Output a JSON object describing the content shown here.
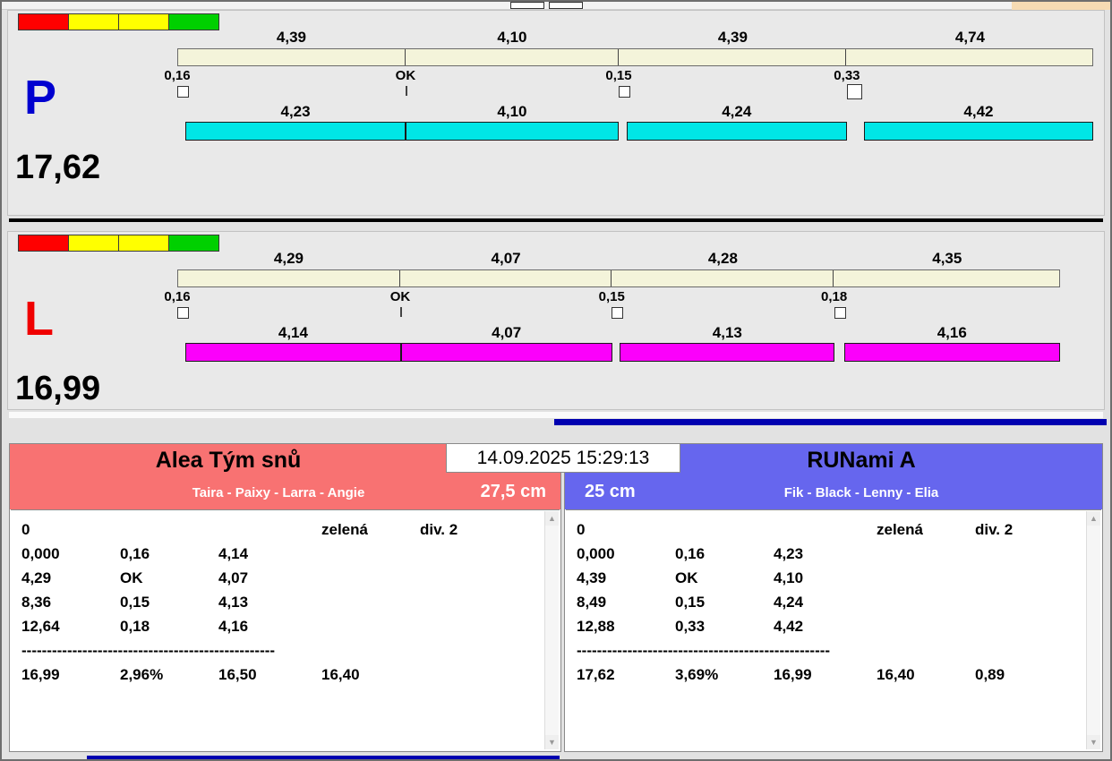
{
  "window": {
    "timestamp": "14.09.2025 15:29:13"
  },
  "colors": {
    "light_red": "#ff0000",
    "light_yellow": "#ffff00",
    "light_green": "#00d000",
    "lane_p_bar": "#00e6e6",
    "lane_l_bar": "#fb00fb",
    "lane_p_letter": "#0000d0",
    "lane_l_letter": "#f00000",
    "team_left_header": "#f87272",
    "team_right_header": "#6666ee",
    "progress_bar": "#0000b0"
  },
  "lanes": [
    {
      "letter": "P",
      "total": "17,62",
      "splits": [
        "4,39",
        "4,10",
        "4,39",
        "4,74"
      ],
      "crossings": [
        "0,16",
        "OK",
        "0,15",
        "0,33"
      ],
      "dog_times": [
        "4,23",
        "4,10",
        "4,24",
        "4,42"
      ]
    },
    {
      "letter": "L",
      "total": "16,99",
      "splits": [
        "4,29",
        "4,07",
        "4,28",
        "4,35"
      ],
      "crossings": [
        "0,16",
        "OK",
        "0,15",
        "0,18"
      ],
      "dog_times": [
        "4,14",
        "4,07",
        "4,13",
        "4,16"
      ]
    }
  ],
  "teams": [
    {
      "name": "Alea Tým snů",
      "members": "Taira - Paixy - Larra - Angie",
      "jump_height": "27,5 cm",
      "rows": [
        [
          "0",
          "",
          "",
          "zelená",
          "div. 2"
        ],
        [
          "0,000",
          "0,16",
          "4,14",
          "",
          ""
        ],
        [
          "4,29",
          "OK",
          "4,07",
          "",
          ""
        ],
        [
          "8,36",
          "0,15",
          "4,13",
          "",
          ""
        ],
        [
          "12,64",
          "0,18",
          "4,16",
          "",
          ""
        ]
      ],
      "separator": "--------------------------------------------------",
      "summary": [
        "16,99",
        "2,96%",
        "16,50",
        "16,40",
        ""
      ]
    },
    {
      "name": "RUNami A",
      "members": "Fik - Black - Lenny - Elia",
      "jump_height": "25 cm",
      "rows": [
        [
          "0",
          "",
          "",
          "zelená",
          "div. 2"
        ],
        [
          "0,000",
          "0,16",
          "4,23",
          "",
          ""
        ],
        [
          "4,39",
          "OK",
          "4,10",
          "",
          ""
        ],
        [
          "8,49",
          "0,15",
          "4,24",
          "",
          ""
        ],
        [
          "12,88",
          "0,33",
          "4,42",
          "",
          ""
        ]
      ],
      "separator": "--------------------------------------------------",
      "summary": [
        "17,62",
        "3,69%",
        "16,99",
        "16,40",
        "0,89"
      ]
    }
  ]
}
